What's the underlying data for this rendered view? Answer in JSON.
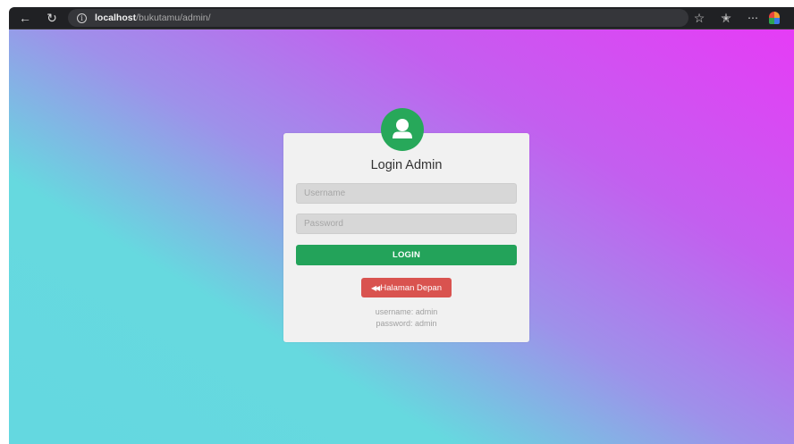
{
  "browser": {
    "url_host": "localhost",
    "url_path": "/bukutamu/admin/",
    "icons": {
      "back": "back-arrow-icon",
      "refresh": "refresh-icon",
      "info": "info-icon",
      "star": "star-icon",
      "favorites": "favorites-icon",
      "more": "more-icon",
      "profile": "profile-icon"
    }
  },
  "login": {
    "title": "Login Admin",
    "username_placeholder": "Username",
    "password_placeholder": "Password",
    "login_label": "LOGIN",
    "home_label": "Halaman Depan",
    "hint_username": "username: admin",
    "hint_password": "password: admin"
  },
  "colors": {
    "avatar": "#27a85a",
    "login_button": "#23a35a",
    "home_button": "#d9534f",
    "gradient_start": "#64d8e0",
    "gradient_end": "#e63cf6"
  }
}
